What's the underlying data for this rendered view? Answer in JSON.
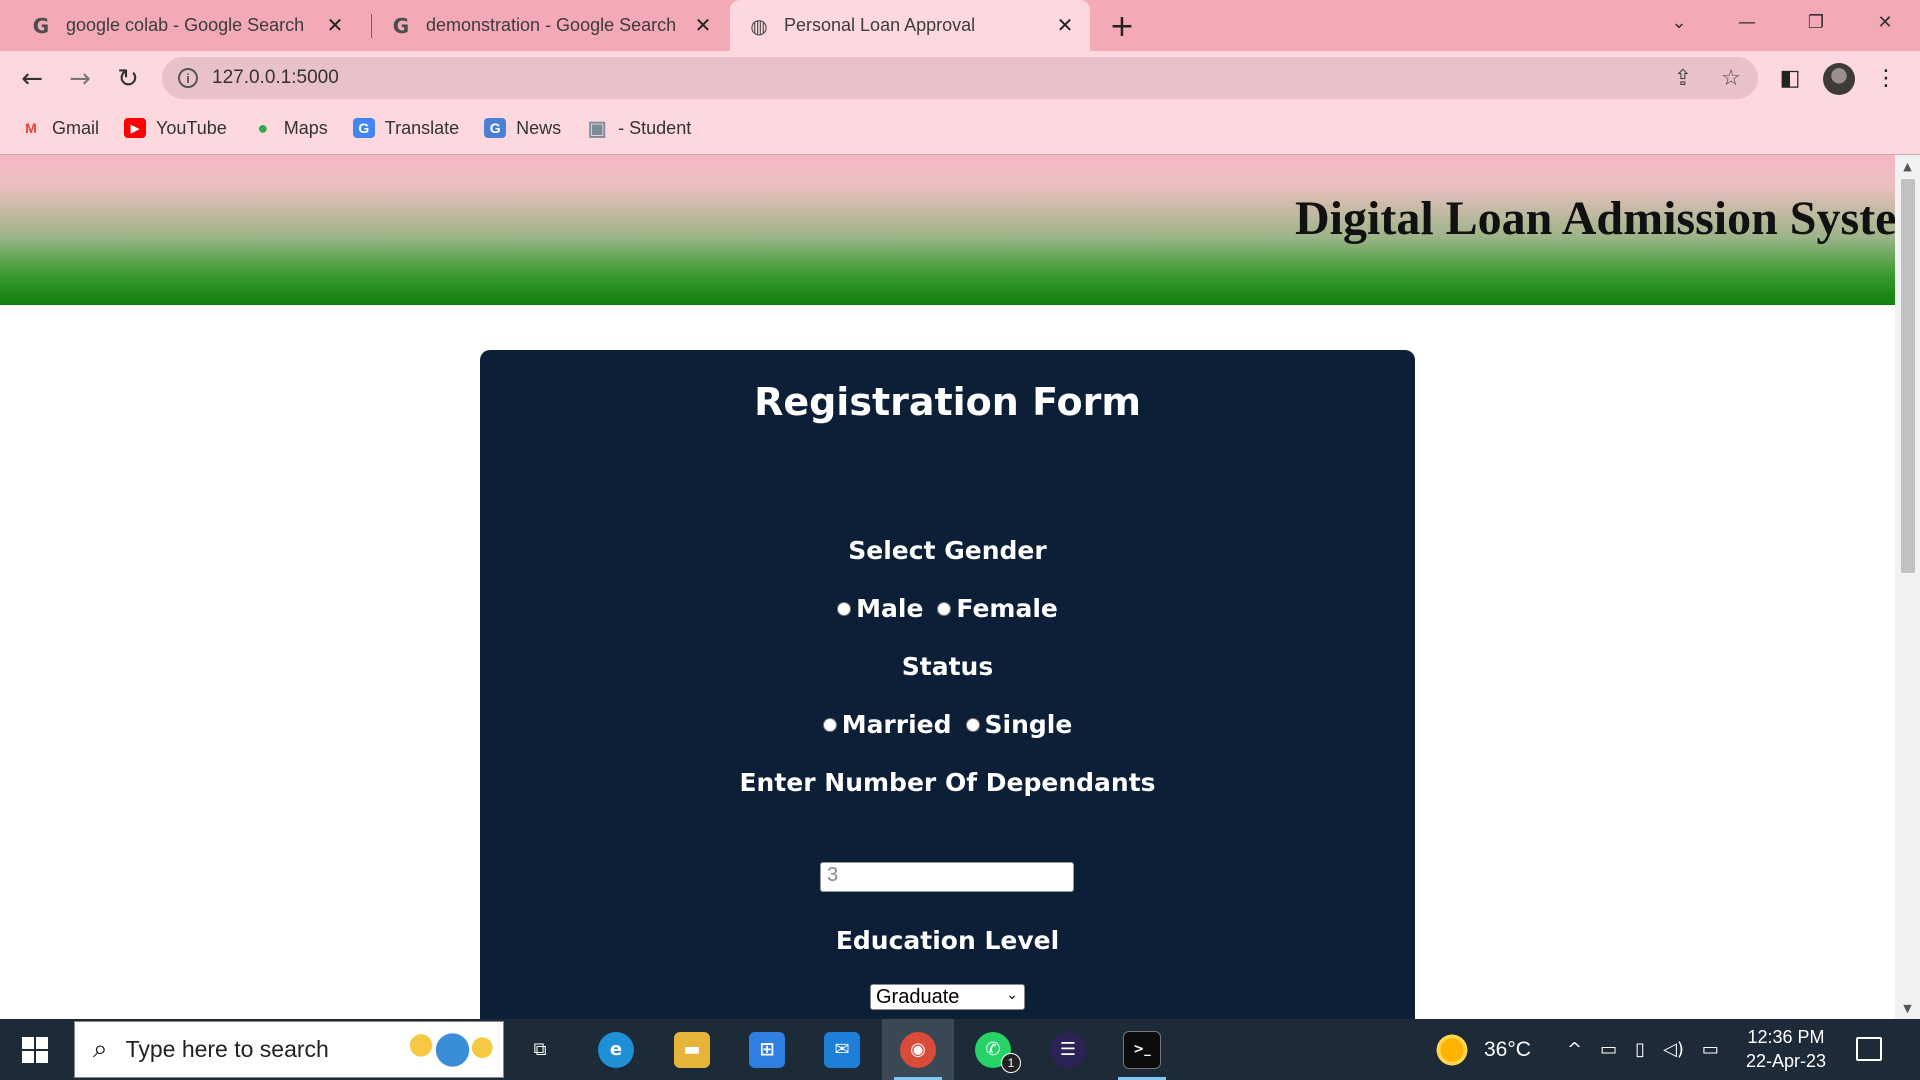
{
  "browser": {
    "tabs": [
      {
        "title": "google colab - Google Search",
        "icon": "google-g-icon",
        "active": false
      },
      {
        "title": "demonstration - Google Search",
        "icon": "google-g-icon",
        "active": false
      },
      {
        "title": "Personal Loan Approval",
        "icon": "globe-icon",
        "active": true
      }
    ],
    "tab_icon_glyphs": {
      "google": "G",
      "globe": "◍"
    },
    "close_glyph": "✕",
    "new_tab_glyph": "+",
    "window_controls": {
      "tab_search": "⌄",
      "minimize": "—",
      "restore": "❐",
      "close": "✕"
    },
    "nav": {
      "back": "←",
      "forward": "→",
      "reload": "↻"
    },
    "address_bar": {
      "url": "127.0.0.1:5000",
      "info_glyph": "i",
      "share_glyph": "⇪",
      "star_glyph": "☆"
    },
    "side_panel_glyph": "◧",
    "menu_glyph": "⋮",
    "bookmarks": [
      {
        "label": "Gmail",
        "icon": "gmail-icon",
        "glyph": "M",
        "color": "#ea4335"
      },
      {
        "label": "YouTube",
        "icon": "youtube-icon",
        "glyph": "▶",
        "color": "#ff0000"
      },
      {
        "label": "Maps",
        "icon": "maps-pin-icon",
        "glyph": "●",
        "color": "#34a853"
      },
      {
        "label": "Translate",
        "icon": "translate-icon",
        "glyph": "G",
        "color": "#4285f4"
      },
      {
        "label": "News",
        "icon": "news-icon",
        "glyph": "G",
        "color": "#4a7fd4"
      },
      {
        "label": "- Student",
        "icon": "student-image-icon",
        "glyph": "▣",
        "color": "#7b8c9a"
      }
    ]
  },
  "page": {
    "banner_title": "Digital Loan Admission Syste",
    "form": {
      "title": "Registration Form",
      "gender_label": "Select Gender",
      "gender_options": [
        "Male",
        "Female"
      ],
      "status_label": "Status",
      "status_options": [
        "Married",
        "Single"
      ],
      "dependants_label": "Enter Number Of Dependants",
      "dependants_placeholder": "3",
      "education_label": "Education Level",
      "education_selected": "Graduate"
    }
  },
  "scrollbar": {
    "up_glyph": "▲",
    "down_glyph": "▼"
  },
  "taskbar": {
    "search_placeholder": "Type here to search",
    "search_glyph": "⌕",
    "apps": [
      {
        "name": "task-view",
        "glyph": "⧉",
        "color": "#1d2b38",
        "active": false
      },
      {
        "name": "edge",
        "glyph": "e",
        "color": "#1f8fd6",
        "active": false
      },
      {
        "name": "file-explorer",
        "glyph": "▬",
        "color": "#e7b43a",
        "active": false
      },
      {
        "name": "microsoft-store",
        "glyph": "⊞",
        "color": "#2f7fe0",
        "active": false
      },
      {
        "name": "mail",
        "glyph": "✉",
        "color": "#1d7fd8",
        "active": false
      },
      {
        "name": "chrome",
        "glyph": "◉",
        "color": "#d94a38",
        "active": true
      },
      {
        "name": "whatsapp",
        "glyph": "✆",
        "color": "#25d366",
        "active": false,
        "badge": "1"
      },
      {
        "name": "eclipse",
        "glyph": "☰",
        "color": "#2c2255",
        "active": false
      },
      {
        "name": "terminal",
        "glyph": ">_",
        "color": "#0c0c0c",
        "active": false
      }
    ],
    "weather": "36°C",
    "tray_glyphs": {
      "chevron": "^",
      "battery": "▭",
      "tablet": "▯",
      "volume": "◁)",
      "network": "▭"
    },
    "time": "12:36 PM",
    "date": "22-Apr-23"
  }
}
